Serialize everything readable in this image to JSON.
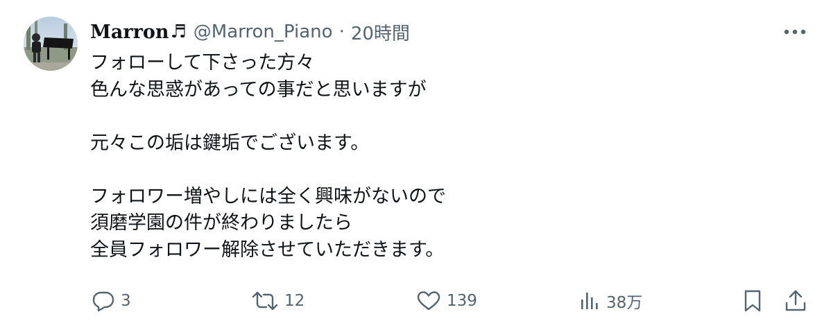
{
  "tweet": {
    "author": {
      "display_name": "Marron",
      "name_emoji": "♬",
      "handle": "@Marron_Piano",
      "separator": "·",
      "time": "20時間"
    },
    "text_lines": [
      "フォローして下さった方々",
      "色んな思惑があっての事だと思いますが",
      "",
      "元々この垢は鍵垢でございます。",
      "",
      "フォロワー増やしには全く興味がないので",
      "須磨学園の件が終わりましたら",
      "全員フォロワー解除させていただきます。"
    ],
    "actions": {
      "reply_count": "3",
      "retweet_count": "12",
      "like_count": "139",
      "view_count": "38万"
    },
    "icons": {
      "reply": "reply-icon",
      "retweet": "retweet-icon",
      "like": "heart-icon",
      "views": "views-icon",
      "bookmark": "bookmark-icon",
      "share": "share-icon",
      "more": "more-icon"
    },
    "colors": {
      "text": "#0f1419",
      "secondary": "#536471"
    }
  }
}
